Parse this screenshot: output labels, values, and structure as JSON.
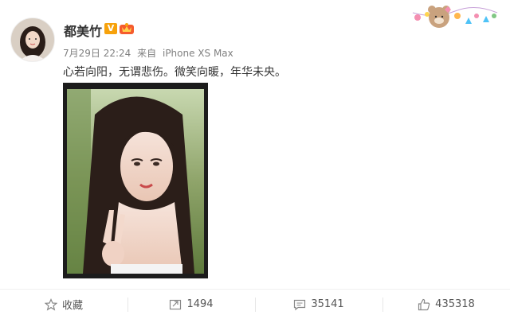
{
  "user": {
    "name": "都美竹",
    "verified_badge": "V",
    "vip_color": "#f7a20b"
  },
  "meta": {
    "time": "7月29日 22:24",
    "source_prefix": "来自",
    "source_device": "iPhone XS Max"
  },
  "post": {
    "text": "心若向阳，无谓悲伤。微笑向暖，年华未央。"
  },
  "actions": {
    "favorite_label": "收藏",
    "repost_count": "1494",
    "comment_count": "35141",
    "like_count": "435318"
  },
  "icons": [
    "star-icon",
    "share-icon",
    "comment-icon",
    "thumbs-up-icon"
  ],
  "colors": {
    "accent": "#f7a20b",
    "text": "#333333",
    "muted": "#808080"
  }
}
